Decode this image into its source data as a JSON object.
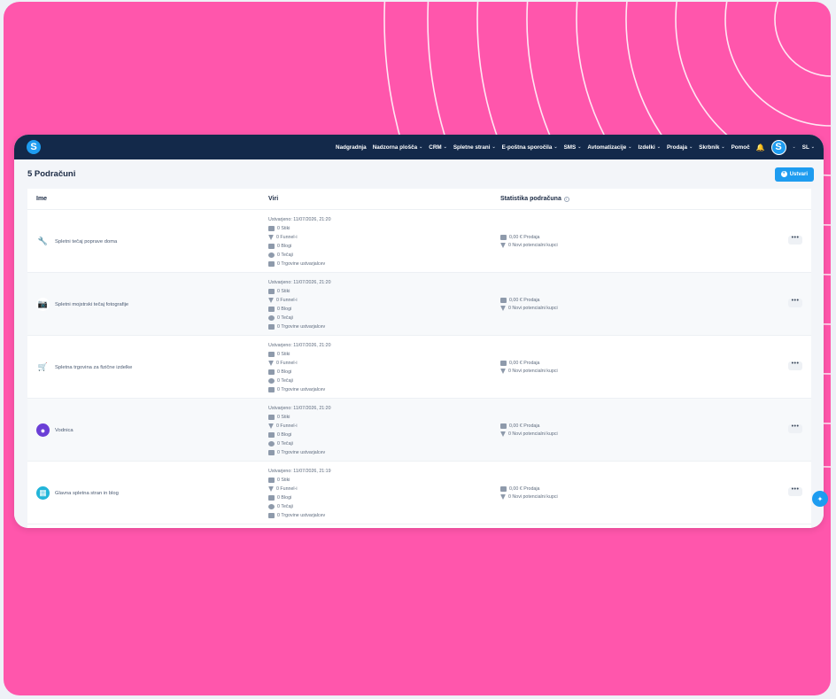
{
  "colors": {
    "background": "#ff56ac",
    "topbar": "#13294a",
    "accent": "#1e9cf0"
  },
  "brand": {
    "logo_letter": "S"
  },
  "nav": [
    {
      "label": "Nadgradnja",
      "dropdown": false
    },
    {
      "label": "Nadzorna plošča",
      "dropdown": true
    },
    {
      "label": "CRM",
      "dropdown": true
    },
    {
      "label": "Spletne strani",
      "dropdown": true
    },
    {
      "label": "E-poštna sporočila",
      "dropdown": true
    },
    {
      "label": "SMS",
      "dropdown": true
    },
    {
      "label": "Avtomatizacije",
      "dropdown": true
    },
    {
      "label": "Izdelki",
      "dropdown": true
    },
    {
      "label": "Prodaja",
      "dropdown": true
    },
    {
      "label": "Skrbnik",
      "dropdown": true
    },
    {
      "label": "Pomoč",
      "dropdown": false
    }
  ],
  "user": {
    "avatar_letter": "S",
    "language": "SL"
  },
  "page": {
    "title": "5 Podračuni",
    "create_label": "Ustvari"
  },
  "table": {
    "headers": {
      "name": "Ime",
      "sources": "Viri",
      "stats": "Statistika podračuna"
    },
    "rows": [
      {
        "name": "Spletni tečaj poprave doma",
        "icon": "house-repair-icon",
        "icon_bg": "#ffffff",
        "icon_glyph": "🔧",
        "created": "Ustvarjeno: 11/07/2026, 21:20",
        "sources": [
          "0 Stiki",
          "0 Funnel-i",
          "0 Blogi",
          "0 Tečaji",
          "0 Trgovine ustvarjalcev"
        ],
        "stats": [
          "0,00 € Prodaja",
          "0 Novi potencialni kupci"
        ]
      },
      {
        "name": "Spletni mojstrski tečaj fotografije",
        "icon": "camera-icon",
        "icon_bg": "#ffffff",
        "icon_glyph": "📷",
        "created": "Ustvarjeno: 11/07/2026, 21:20",
        "sources": [
          "0 Stiki",
          "0 Funnel-i",
          "0 Blogi",
          "0 Tečaji",
          "0 Trgovine ustvarjalcev"
        ],
        "stats": [
          "0,00 € Prodaja",
          "0 Novi potencialni kupci"
        ]
      },
      {
        "name": "Spletna trgovina za fizične izdelke",
        "icon": "shopping-cart-icon",
        "icon_bg": "#ffffff",
        "icon_glyph": "🛒",
        "created": "Ustvarjeno: 11/07/2026, 21:20",
        "sources": [
          "0 Stiki",
          "0 Funnel-i",
          "0 Blogi",
          "0 Tečaji",
          "0 Trgovine ustvarjalcev"
        ],
        "stats": [
          "0,00 € Prodaja",
          "0 Novi potencialni kupci"
        ]
      },
      {
        "name": "Vodnica",
        "icon": "guide-logo-icon",
        "icon_bg": "#6b3fd6",
        "icon_glyph": "●",
        "created": "Ustvarjeno: 11/07/2026, 21:20",
        "sources": [
          "0 Stiki",
          "0 Funnel-i",
          "0 Blogi",
          "0 Tečaji",
          "0 Trgovine ustvarjalcev"
        ],
        "stats": [
          "0,00 € Prodaja",
          "0 Novi potencialni kupci"
        ]
      },
      {
        "name": "Glavna spletna stran in blog",
        "icon": "website-icon",
        "icon_bg": "#22b5d9",
        "icon_glyph": "▦",
        "created": "Ustvarjeno: 11/07/2026, 21:19",
        "sources": [
          "0 Stiki",
          "0 Funnel-i",
          "0 Blogi",
          "0 Tečaji",
          "0 Trgovine ustvarjalcev"
        ],
        "stats": [
          "0,00 € Prodaja",
          "0 Novi potencialni kupci"
        ]
      }
    ]
  },
  "source_icons": [
    "contacts-icon",
    "funnel-icon",
    "blog-icon",
    "course-icon",
    "store-icon"
  ],
  "stat_icons": [
    "money-icon",
    "funnel-icon"
  ],
  "more_label": "•••"
}
